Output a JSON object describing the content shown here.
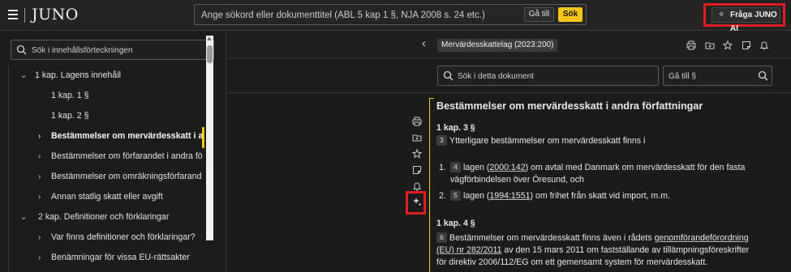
{
  "app": {
    "logo": "JUNO"
  },
  "top_search": {
    "placeholder": "Ange sökord eller dokumenttitel (ABL 5 kap 1 §, NJA 2008 s. 24 etc.)",
    "goto_label": "Gå till",
    "search_label": "Sök",
    "ai_label": "Fråga JUNO AI"
  },
  "sidebar": {
    "search_placeholder": "Sök i innehållsförteckningen",
    "items": [
      {
        "label": "1 kap. Lagens innehåll",
        "chevron": "v"
      },
      {
        "label": "1 kap. 1 §",
        "chevron": ""
      },
      {
        "label": "1 kap. 2 §",
        "chevron": ""
      },
      {
        "label": "Bestämmelser om mervärdesskatt i an",
        "chevron": ">"
      },
      {
        "label": "Bestämmelser om förfarandet i andra fö",
        "chevron": ">"
      },
      {
        "label": "Bestämmelser om omräkningsförfarand",
        "chevron": ">"
      },
      {
        "label": "Annan statlig skatt eller avgift",
        "chevron": ">"
      },
      {
        "label": "2 kap. Definitioner och förklaringar",
        "chevron": "v"
      },
      {
        "label": "Var finns definitioner och förklaringar?",
        "chevron": ">"
      },
      {
        "label": "Benämningar för vissa EU-rättsakter",
        "chevron": ">"
      }
    ]
  },
  "doc_header": {
    "title": "Mervärdesskattelag (2023:200)"
  },
  "doc_tools": {
    "search_placeholder": "Sök i detta dokument",
    "goto_placeholder": "Gå till §"
  },
  "document": {
    "heading": "Bestämmelser om mervärdesskatt i andra författningar",
    "p1_heading": "1 kap. 3 §",
    "p1_num": "3",
    "p1_text": "Ytterligare bestämmelser om mervärdesskatt finns i",
    "li1_marker": "1.",
    "li1_num": "4",
    "li1_pre": "lagen (",
    "li1_link": "2000:142",
    "li1_post": ") om avtal med Danmark om mervärdesskatt för den fasta",
    "li1_cont": "vägförbindelsen över Öresund, och",
    "li2_marker": "2.",
    "li2_num": "5",
    "li2_pre": "lagen (",
    "li2_link": "1994:1551",
    "li2_post": ") om frihet från skatt vid import, m.m.",
    "p2_heading": "1 kap. 4 §",
    "p2_num": "6",
    "p2_pre": "Bestämmelser om mervärdesskatt finns även i rådets ",
    "p2_link1": "genomförandeförordning",
    "p2_link2": "(EU) nr 282/2011",
    "p2_post": " av den 15 mars 2011 om fastställande av tillämpningsföreskrifter",
    "p2_last": "för direktiv 2006/112/EG om ett gemensamt system för mervärdesskatt."
  },
  "colors": {
    "accent": "#f5c518",
    "highlight_box": "#e01e24",
    "background": "#1e1e1e"
  }
}
